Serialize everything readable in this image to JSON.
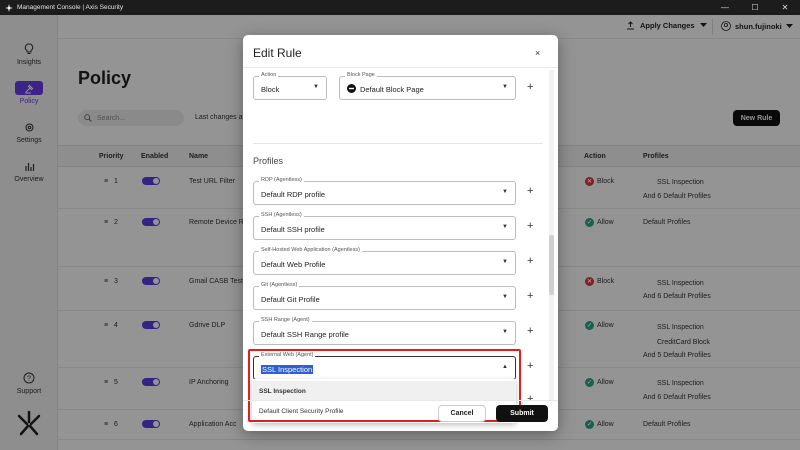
{
  "window": {
    "title": "Management Console | Axis Security",
    "minimize": "—",
    "maximize": "☐",
    "close": "✕"
  },
  "sidebar": {
    "items": [
      {
        "label": "Insights",
        "icon": "lightbulb-icon"
      },
      {
        "label": "Policy",
        "icon": "gavel-icon",
        "active": true
      },
      {
        "label": "Settings",
        "icon": "gear-icon"
      },
      {
        "label": "Overview",
        "icon": "bar-chart-icon"
      }
    ],
    "support": "Support"
  },
  "header": {
    "apply_changes": "Apply Changes",
    "user": "shun.fujinoki"
  },
  "page": {
    "title": "Policy",
    "search_placeholder": "Search...",
    "last_changes": "Last changes ap",
    "new_rule": "New Rule"
  },
  "table": {
    "columns": {
      "priority": "Priority",
      "enabled": "Enabled",
      "name": "Name",
      "action": "Action",
      "profiles": "Profiles"
    },
    "rows": [
      {
        "priority": "1",
        "name": "Test URL Filter",
        "action": "Block",
        "profile1": "SSL Inspection",
        "profile2": "And 6 Default Profiles"
      },
      {
        "priority": "2",
        "name": "Remote Device R",
        "action": "Allow",
        "profile1": "Default Profiles",
        "profile2": ""
      },
      {
        "priority": "3",
        "name": "Gmail CASB Test",
        "action": "Block",
        "profile1": "SSL Inspection",
        "profile2": "And 6 Default Profiles"
      },
      {
        "priority": "4",
        "name": "Gdrive DLP",
        "action": "Allow",
        "profile1": "SSL Inspection",
        "profile2": "CreditCard Block",
        "profile3": "And 5 Default Profiles"
      },
      {
        "priority": "5",
        "name": "IP Anchoring",
        "action": "Allow",
        "profile1": "SSL Inspection",
        "profile2": "And 6 Default Profiles"
      },
      {
        "priority": "6",
        "name": "Application Acc",
        "action": "Allow",
        "profile1": "Default Profiles",
        "profile2": ""
      }
    ]
  },
  "modal": {
    "title": "Edit Rule",
    "close": "×",
    "action": {
      "label": "Action",
      "value": "Block"
    },
    "block_page": {
      "label": "Block Page",
      "value": "Default Block Page"
    },
    "profiles_title": "Profiles",
    "profiles": [
      {
        "label": "RDP (Agentless)",
        "value": "Default RDP profile"
      },
      {
        "label": "SSH (Agentless)",
        "value": "Default SSH profile"
      },
      {
        "label": "Self-Hosted Web Application (Agentless)",
        "value": "Default Web Profile"
      },
      {
        "label": "Git (Agentless)",
        "value": "Default Git Profile"
      },
      {
        "label": "SSH Range (Agent)",
        "value": "Default SSH Range profile"
      }
    ],
    "external_web": {
      "label": "External Web (Agent)",
      "value": "SSL Inspection"
    },
    "dropdown_options": [
      "SSL Inspection",
      "Default Client Security Profile"
    ],
    "cancel": "Cancel",
    "submit": "Submit",
    "plus": "+"
  }
}
